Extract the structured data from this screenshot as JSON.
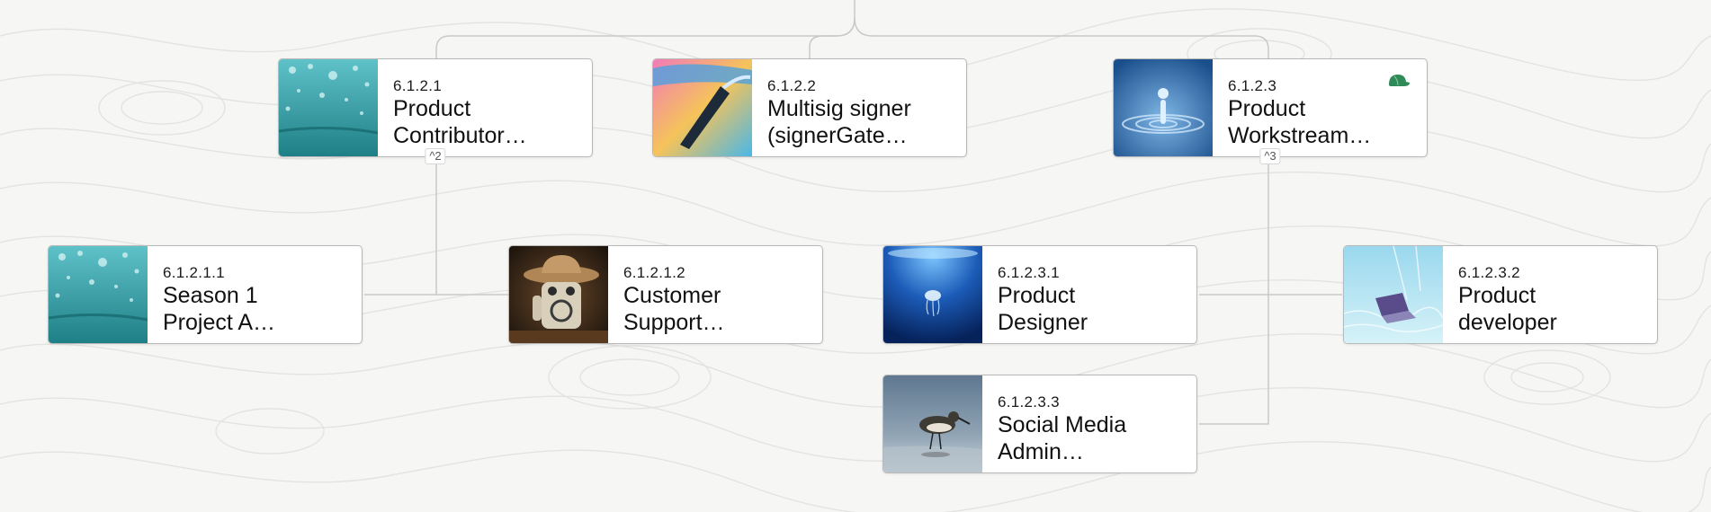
{
  "nodes": {
    "n1": {
      "code": "6.1.2.1",
      "line1": "Product",
      "line2": "Contributor…",
      "badge": "^2"
    },
    "n2": {
      "code": "6.1.2.2",
      "line1": "Multisig signer",
      "line2": "(signerGate…"
    },
    "n3": {
      "code": "6.1.2.3",
      "line1": "Product",
      "line2": "Workstream…",
      "badge": "^3",
      "icon": "green-cap-icon"
    },
    "n4": {
      "code": "6.1.2.1.1",
      "line1": "Season 1",
      "line2": "Project A…"
    },
    "n5": {
      "code": "6.1.2.1.2",
      "line1": "Customer",
      "line2": "Support…"
    },
    "n6": {
      "code": "6.1.2.3.1",
      "line1": "Product",
      "line2": "Designer"
    },
    "n7": {
      "code": "6.1.2.3.2",
      "line1": "Product",
      "line2": "developer"
    },
    "n8": {
      "code": "6.1.2.3.3",
      "line1": "Social Media",
      "line2": "Admin…"
    }
  },
  "colors": {
    "accent_icon": "#2e8b57",
    "connector": "#c8c8c8",
    "contour": "#e2e2e0"
  }
}
